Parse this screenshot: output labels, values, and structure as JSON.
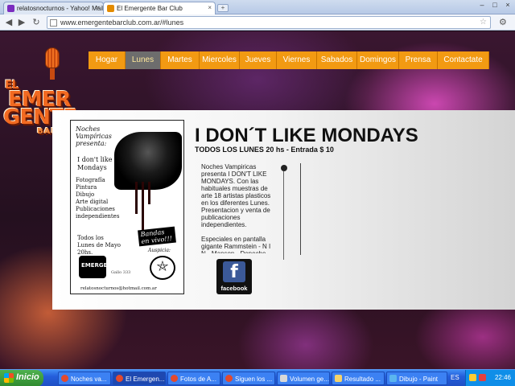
{
  "browser": {
    "tabs": [
      {
        "label": "relatosnocturnos - Yahoo! Mail",
        "active": false
      },
      {
        "label": "El Emergente Bar Club",
        "active": true
      }
    ],
    "url": "www.emergentebarclub.com.ar/#lunes"
  },
  "site": {
    "logo": {
      "line1": "EL",
      "line2": "EMER",
      "line3": "GENTE",
      "line4": "BAR CLUB"
    },
    "nav": [
      {
        "label": "Hogar",
        "active": false
      },
      {
        "label": "Lunes",
        "active": true
      },
      {
        "label": "Martes",
        "active": false
      },
      {
        "label": "Miercoles",
        "active": false
      },
      {
        "label": "Jueves",
        "active": false
      },
      {
        "label": "Viernes",
        "active": false
      },
      {
        "label": "Sabados",
        "active": false
      },
      {
        "label": "Domingos",
        "active": false
      },
      {
        "label": "Prensa",
        "active": false
      },
      {
        "label": "Contactate",
        "active": false
      }
    ]
  },
  "poster": {
    "header": "Noches Vampíricas presenta:",
    "title": "I don't like Mondays",
    "items": [
      "Fotografía",
      "Pintura",
      "Dibujo",
      "Arte digital",
      "Publicaciones",
      "independientes"
    ],
    "bandas": "Bandas en vivo!!!",
    "date": "Todos los Lunes de Mayo 20hs.",
    "logo_text": "EMERGENTE",
    "gallo": "Gallo 333",
    "auspicia": "Auspicia:",
    "email": "relatosnocturnos@hotmail.com.ar"
  },
  "event": {
    "title": "I DON´T LIKE MONDAYS",
    "subtitle": "TODOS LOS LUNES 20 hs -  Entrada $ 10",
    "paragraph1": "Noches Vampiricas presenta I DON'T LIKE MONDAYS. Con las habituales muestras de arte  18 artistas plasticos en los diferentes Lunes. Presentacion y venta de publicaciones independientes.",
    "paragraph2": "Especiales en pantalla gigante  Rammstein - N I N - Manson - Depeche Mode"
  },
  "facebook": {
    "label": "facebook"
  },
  "taskbar": {
    "start": "Inicio",
    "buttons": [
      {
        "label": "Noches va...",
        "active": false
      },
      {
        "label": "El Emergen...",
        "active": true
      },
      {
        "label": "Fotos de A...",
        "active": false
      },
      {
        "label": "Siguen los ...",
        "active": false
      },
      {
        "label": "Volumen ge...",
        "active": false
      },
      {
        "label": "Resultado ...",
        "active": false
      },
      {
        "label": "Dibujo - Paint",
        "active": false
      }
    ],
    "lang": "ES",
    "clock": "22:46"
  }
}
